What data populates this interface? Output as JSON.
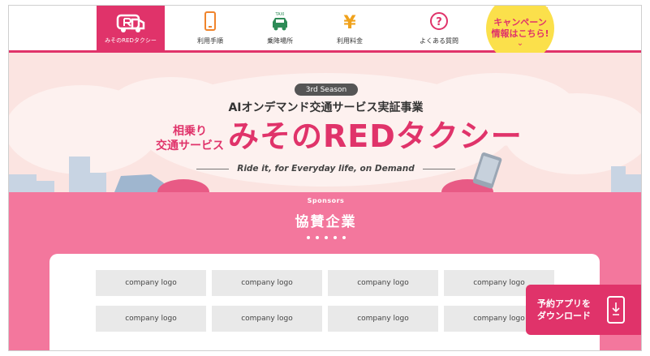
{
  "nav": {
    "logo_text": "みそのREDタクシー",
    "items": [
      {
        "label": "利用手順",
        "icon": "smartphone-icon"
      },
      {
        "label": "乗降場所",
        "icon": "taxi-icon"
      },
      {
        "label": "利用料金",
        "icon": "yen-icon"
      },
      {
        "label": "よくある質問",
        "icon": "question-icon"
      }
    ],
    "taxi_sign": "TAXI",
    "yen": "¥",
    "question_mark": "?",
    "campaign": {
      "line1": "キャンペーン",
      "line2": "情報はこちら!",
      "chevron": "⌄"
    }
  },
  "hero": {
    "season": "3rd Season",
    "subtitle": "AIオンデマンド交通サービス実証事業",
    "tag_line1": "相乗り",
    "tag_line2": "交通サービス",
    "title": "みそのREDタクシー",
    "tagline": "Ride it, for Everyday life, on Demand"
  },
  "sponsors": {
    "heading_en": "Sponsors",
    "heading_jp": "協賛企業",
    "logos": [
      "company logo",
      "company logo",
      "company logo",
      "company logo",
      "company logo",
      "company logo",
      "company logo",
      "company logo"
    ]
  },
  "download": {
    "line1": "予約アプリを",
    "line2": "ダウンロード"
  },
  "colors": {
    "brand": "#e0336a",
    "sponsor_bg": "#f3779d",
    "hero_bg": "#fbe4e1",
    "campaign": "#fbe04b"
  }
}
